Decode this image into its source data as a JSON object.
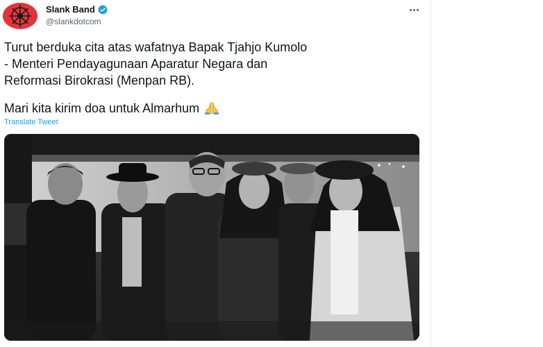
{
  "account": {
    "display_name": "Slank Band",
    "handle": "@slankdotcom",
    "verified": true,
    "avatar_icon": "slank-logo-icon",
    "avatar_color": "#e3343b"
  },
  "menu": {
    "icon": "more-horizontal-icon"
  },
  "tweet": {
    "line1": "Turut berduka cita atas wafatnya Bapak Tjahjo Kumolo",
    "line2": "- Menteri Pendayagunaan Aparatur Negara dan",
    "line3": "Reformasi Birokrasi (Menpan RB).",
    "line4": "Mari kita kirim doa untuk Almarhum",
    "emoji_icon": "folded-hands-icon"
  },
  "translate_label": "Translate Tweet",
  "photo": {
    "icon": "group-photo-image"
  },
  "colors": {
    "link": "#1d9bf0",
    "verified": "#1d9bf0",
    "text": "#0f1419",
    "muted": "#536471"
  }
}
